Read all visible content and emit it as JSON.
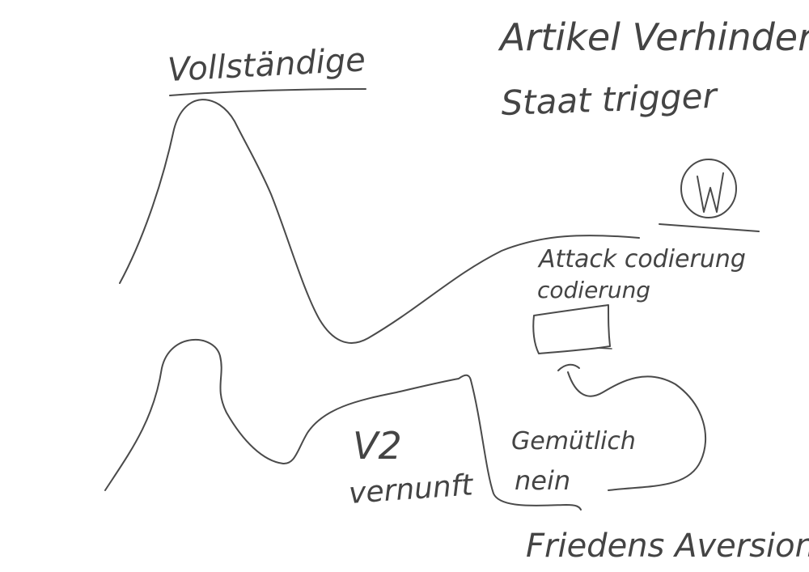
{
  "labels": {
    "vollstaendige": "Vollständige",
    "artikel": "Artikel Verhindern",
    "staat_trigger": "Staat trigger",
    "attack_codierung": "Attack codierung",
    "codierung": "codierung",
    "v2": "V2",
    "vernunft": "vernunft",
    "gemuetlich": "Gemütlich",
    "nein": "nein",
    "friedens_aversion": "Friedens Aversion"
  },
  "colors": {
    "ink": "#4a4a4a",
    "background": "#ffffff"
  },
  "symbols": {
    "circle_w": "circled-w-icon",
    "box": "rectangle-box"
  }
}
